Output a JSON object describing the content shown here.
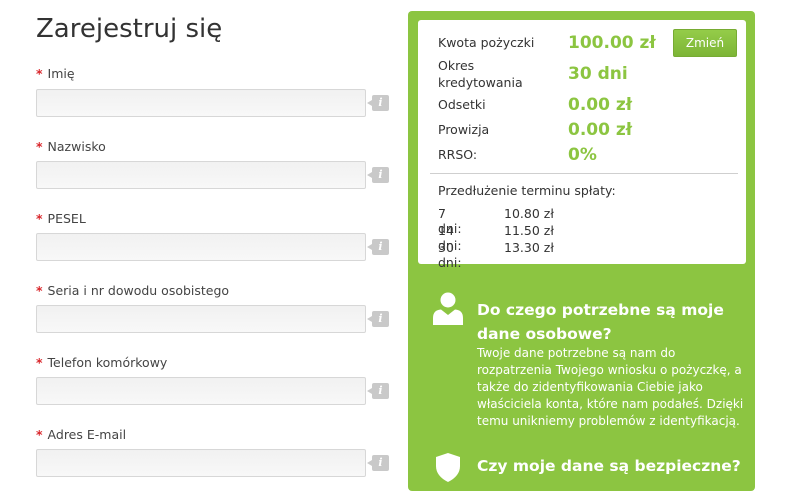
{
  "form": {
    "title": "Zarejestruj się",
    "required_mark": "*",
    "info_symbol": "i",
    "fields": [
      {
        "label": "Imię",
        "value": ""
      },
      {
        "label": "Nazwisko",
        "value": ""
      },
      {
        "label": "PESEL",
        "value": ""
      },
      {
        "label": "Seria i nr dowodu osobistego",
        "value": ""
      },
      {
        "label": "Telefon komórkowy",
        "value": ""
      },
      {
        "label": "Adres E-mail",
        "value": ""
      }
    ]
  },
  "summary": {
    "amount_label": "Kwota pożyczki",
    "amount_value": "100.00 zł",
    "period_label_line1": "Okres",
    "period_label_line2": "kredytowania",
    "period_value": "30 dni",
    "interest_label": "Odsetki",
    "interest_value": "0.00 zł",
    "fee_label": "Prowizja",
    "fee_value": "0.00 zł",
    "rrso_label": "RRSO:",
    "rrso_value": "0%",
    "change_button": "Zmień",
    "extension_title": "Przedłużenie terminu spłaty:",
    "extensions": [
      {
        "days": "7 dni:",
        "price": "10.80 zł"
      },
      {
        "days": "14 dni:",
        "price": "11.50 zł"
      },
      {
        "days": "30 dni:",
        "price": "13.30 zł"
      }
    ]
  },
  "faq": [
    {
      "icon": "user-icon",
      "title": "Do czego potrzebne są moje dane osobowe?",
      "text": "Twoje dane potrzebne są nam do rozpatrzenia Twojego wniosku o pożyczkę, a także do zidentyfikowania Ciebie jako właściciela konta, które nam podałeś. Dzięki temu unikniemy problemów z identyfikacją."
    },
    {
      "icon": "shield-icon",
      "title": "Czy moje dane są bezpieczne?",
      "text": ""
    }
  ],
  "colors": {
    "accent_green": "#8cc541",
    "required_red": "#d9262b"
  }
}
